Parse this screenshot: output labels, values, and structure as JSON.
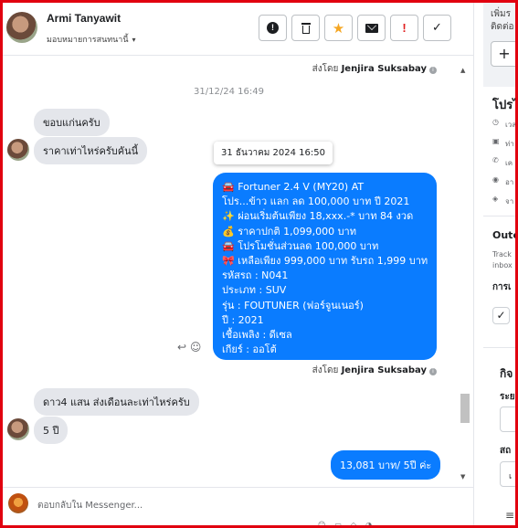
{
  "header": {
    "name": "Armi Tanyawit",
    "assignee": "มอบหมายการสนทนานี้",
    "chevron": "▾",
    "actions": [
      {
        "name": "mark-spam-button",
        "glyph": "⓿"
      },
      {
        "name": "delete-button",
        "glyph": "🗑"
      },
      {
        "name": "star-button",
        "glyph": "★"
      },
      {
        "name": "mark-unread-button",
        "glyph": "✉"
      },
      {
        "name": "follow-up-button",
        "glyph": "!"
      },
      {
        "name": "mark-done-button",
        "glyph": "✓"
      }
    ]
  },
  "messages": {
    "sent_by_prefix": "ส่งโดย",
    "agent_name": "Jenjira Suksabay",
    "timestamp": "31/12/24 16:49",
    "incoming_1": "ขอบแก่นครับ",
    "incoming_2": "ราคาเท่าไหร่ครับคันนี้",
    "tooltip": "31 ธันวาคม 2024 16:50",
    "offer_lines": [
      "🚘 Fortuner 2.4 V (MY20) AT",
      "    โปร...ข้าว แลก ลด 100,000 บาท ปี 2021",
      "✨ ผ่อนเริ่มต้นเพียง 18,xxx.-* บาท 84 งวด",
      "💰 ราคาปกติ 1,099,000 บาท",
      "🚘 โปรโมชั่นส่วนลด 100,000 บาท",
      "🎀 เหลือเพียง 999,000 บาท รับรถ 1,999 บาท",
      "   รหัสรถ : N041",
      "   ประเภท : SUV",
      "   รุ่น : FOUTUNER (ฟอร์จูนเนอร์)",
      "   ปี : 2021",
      "   เชื้อเพลิง : ดีเซล",
      "   เกียร์ : ออโต้"
    ],
    "incoming_3": "ดาว4 แสน ส่งเดือนละเท่าไหร่ครับ",
    "incoming_4": "5 ปี",
    "outgoing_reply": "13,081 บาท/ 5ปี ค่ะ"
  },
  "composer": {
    "placeholder": "ตอบกลับใน Messenger..."
  },
  "sidebar": {
    "add_label_top": "เพิ่มร",
    "add_label_sub": "ติดต่อ",
    "add_button": "+",
    "profile_title": "โปรไ",
    "profile_rows": [
      "เวล",
      "ท่า",
      "เค",
      "อา",
      "จา"
    ],
    "outcome_title": "Outc",
    "track_line1": "Track",
    "track_line2": "inbox",
    "activity_label": "การเ",
    "tasks_title": "กิจ",
    "field_label_1": "ระย",
    "field_label_2": "สถ",
    "field_value_2": "เ"
  },
  "colors": {
    "accent_blue": "#0a7cff",
    "incoming_bubble": "#e4e6eb",
    "star_orange": "#f5a623",
    "alert_red": "#e02020",
    "frame_red": "#e1000f"
  }
}
